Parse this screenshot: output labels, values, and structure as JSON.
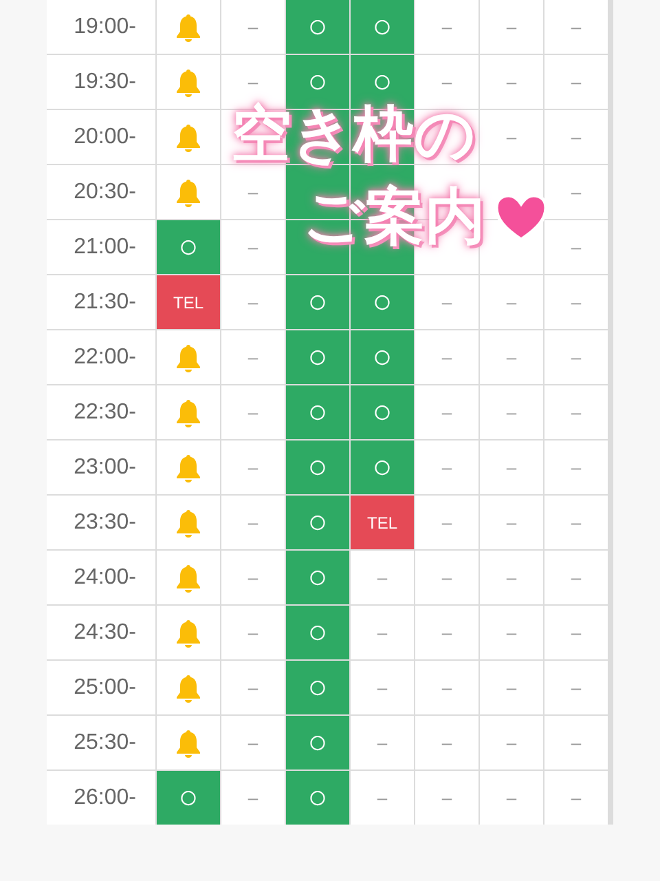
{
  "overlay": {
    "line_1": "空き枠の",
    "line_2": "ご案内"
  },
  "rows": [
    {
      "time": "19:00-",
      "cells": [
        {
          "kind": "bell"
        },
        {
          "kind": "none",
          "text": "–"
        },
        {
          "kind": "open",
          "text": "○"
        },
        {
          "kind": "open",
          "text": "○"
        },
        {
          "kind": "none",
          "text": "–"
        },
        {
          "kind": "none",
          "text": "–"
        },
        {
          "kind": "none",
          "text": "–"
        }
      ]
    },
    {
      "time": "19:30-",
      "cells": [
        {
          "kind": "bell"
        },
        {
          "kind": "none",
          "text": "–"
        },
        {
          "kind": "open",
          "text": "○"
        },
        {
          "kind": "open",
          "text": "○"
        },
        {
          "kind": "none",
          "text": "–"
        },
        {
          "kind": "none",
          "text": "–"
        },
        {
          "kind": "none",
          "text": "–"
        }
      ]
    },
    {
      "time": "20:00-",
      "cells": [
        {
          "kind": "bell"
        },
        {
          "kind": "none"
        },
        {
          "kind": "open"
        },
        {
          "kind": "open"
        },
        {
          "kind": "none"
        },
        {
          "kind": "none",
          "text": "–"
        },
        {
          "kind": "none",
          "text": "–"
        }
      ]
    },
    {
      "time": "20:30-",
      "cells": [
        {
          "kind": "bell"
        },
        {
          "kind": "none",
          "text": "–"
        },
        {
          "kind": "open"
        },
        {
          "kind": "open"
        },
        {
          "kind": "none"
        },
        {
          "kind": "none"
        },
        {
          "kind": "none",
          "text": "–"
        }
      ]
    },
    {
      "time": "21:00-",
      "cells": [
        {
          "kind": "open",
          "text": "○"
        },
        {
          "kind": "none",
          "text": "–"
        },
        {
          "kind": "open"
        },
        {
          "kind": "open"
        },
        {
          "kind": "none"
        },
        {
          "kind": "none"
        },
        {
          "kind": "none",
          "text": "–"
        }
      ]
    },
    {
      "time": "21:30-",
      "cells": [
        {
          "kind": "tel",
          "text": "TEL"
        },
        {
          "kind": "none",
          "text": "–"
        },
        {
          "kind": "open",
          "text": "○"
        },
        {
          "kind": "open",
          "text": "○"
        },
        {
          "kind": "none",
          "text": "–"
        },
        {
          "kind": "none",
          "text": "–"
        },
        {
          "kind": "none",
          "text": "–"
        }
      ]
    },
    {
      "time": "22:00-",
      "cells": [
        {
          "kind": "bell"
        },
        {
          "kind": "none",
          "text": "–"
        },
        {
          "kind": "open",
          "text": "○"
        },
        {
          "kind": "open",
          "text": "○"
        },
        {
          "kind": "none",
          "text": "–"
        },
        {
          "kind": "none",
          "text": "–"
        },
        {
          "kind": "none",
          "text": "–"
        }
      ]
    },
    {
      "time": "22:30-",
      "cells": [
        {
          "kind": "bell"
        },
        {
          "kind": "none",
          "text": "–"
        },
        {
          "kind": "open",
          "text": "○"
        },
        {
          "kind": "open",
          "text": "○"
        },
        {
          "kind": "none",
          "text": "–"
        },
        {
          "kind": "none",
          "text": "–"
        },
        {
          "kind": "none",
          "text": "–"
        }
      ]
    },
    {
      "time": "23:00-",
      "cells": [
        {
          "kind": "bell"
        },
        {
          "kind": "none",
          "text": "–"
        },
        {
          "kind": "open",
          "text": "○"
        },
        {
          "kind": "open",
          "text": "○"
        },
        {
          "kind": "none",
          "text": "–"
        },
        {
          "kind": "none",
          "text": "–"
        },
        {
          "kind": "none",
          "text": "–"
        }
      ]
    },
    {
      "time": "23:30-",
      "cells": [
        {
          "kind": "bell"
        },
        {
          "kind": "none",
          "text": "–"
        },
        {
          "kind": "open",
          "text": "○"
        },
        {
          "kind": "tel",
          "text": "TEL"
        },
        {
          "kind": "none",
          "text": "–"
        },
        {
          "kind": "none",
          "text": "–"
        },
        {
          "kind": "none",
          "text": "–"
        }
      ]
    },
    {
      "time": "24:00-",
      "cells": [
        {
          "kind": "bell"
        },
        {
          "kind": "none",
          "text": "–"
        },
        {
          "kind": "open",
          "text": "○"
        },
        {
          "kind": "none",
          "text": "–"
        },
        {
          "kind": "none",
          "text": "–"
        },
        {
          "kind": "none",
          "text": "–"
        },
        {
          "kind": "none",
          "text": "–"
        }
      ]
    },
    {
      "time": "24:30-",
      "cells": [
        {
          "kind": "bell"
        },
        {
          "kind": "none",
          "text": "–"
        },
        {
          "kind": "open",
          "text": "○"
        },
        {
          "kind": "none",
          "text": "–"
        },
        {
          "kind": "none",
          "text": "–"
        },
        {
          "kind": "none",
          "text": "–"
        },
        {
          "kind": "none",
          "text": "–"
        }
      ]
    },
    {
      "time": "25:00-",
      "cells": [
        {
          "kind": "bell"
        },
        {
          "kind": "none",
          "text": "–"
        },
        {
          "kind": "open",
          "text": "○"
        },
        {
          "kind": "none",
          "text": "–"
        },
        {
          "kind": "none",
          "text": "–"
        },
        {
          "kind": "none",
          "text": "–"
        },
        {
          "kind": "none",
          "text": "–"
        }
      ]
    },
    {
      "time": "25:30-",
      "cells": [
        {
          "kind": "bell"
        },
        {
          "kind": "none",
          "text": "–"
        },
        {
          "kind": "open",
          "text": "○"
        },
        {
          "kind": "none",
          "text": "–"
        },
        {
          "kind": "none",
          "text": "–"
        },
        {
          "kind": "none",
          "text": "–"
        },
        {
          "kind": "none",
          "text": "–"
        }
      ]
    },
    {
      "time": "26:00-",
      "cells": [
        {
          "kind": "open",
          "text": "○"
        },
        {
          "kind": "none",
          "text": "–"
        },
        {
          "kind": "open",
          "text": "○"
        },
        {
          "kind": "none",
          "text": "–"
        },
        {
          "kind": "none",
          "text": "–"
        },
        {
          "kind": "none",
          "text": "–"
        },
        {
          "kind": "none",
          "text": "–"
        }
      ]
    }
  ]
}
